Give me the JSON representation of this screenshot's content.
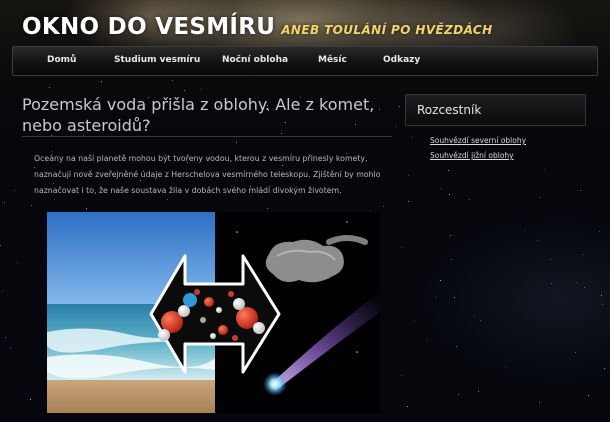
{
  "site": {
    "title": "OKNO DO VESMÍRU",
    "tagline": "ANEB TOULÁNÍ PO HVĚZDÁCH"
  },
  "nav": {
    "items": [
      {
        "label": "Domů"
      },
      {
        "label": "Studium vesmíru"
      },
      {
        "label": "Noční obloha"
      },
      {
        "label": "Měsíc"
      },
      {
        "label": "Odkazy"
      }
    ]
  },
  "article": {
    "title": "Pozemská voda přišla z oblohy. Ale z komet, nebo asteroidů?",
    "text": "Oceány na naší planetě mohou být tvořeny vodou, kterou z vesmíru přinesly komety, naznačují nově zveřejněné údaje z Herschelova vesmírného teleskopu. Zjištění by mohlo naznačovat i to, že naše soustava žila v dobách svého mládí divokým životem."
  },
  "sidebar": {
    "heading": "Rozcestník",
    "links": [
      {
        "label": "Souhvězdí severní oblohy"
      },
      {
        "label": "Souhvězdí jižní oblohy"
      }
    ]
  },
  "colors": {
    "tagline": "#f2d46a",
    "background": "#05070d",
    "navbar": "#1a1a1a"
  }
}
